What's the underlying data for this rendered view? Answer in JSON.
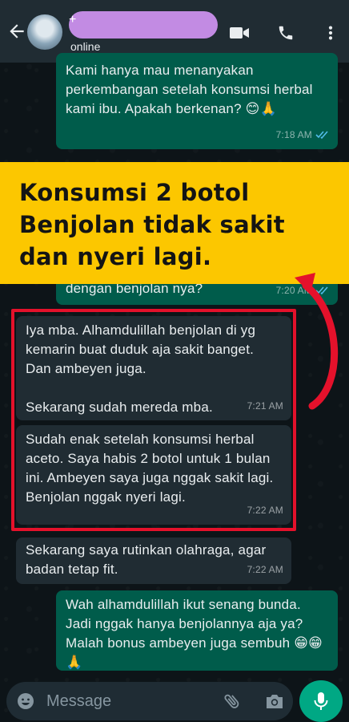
{
  "header": {
    "name_prefix": "+",
    "status": "online"
  },
  "messages": [
    {
      "id": "b1",
      "direction": "out",
      "text": "Kami hanya mau menanyakan perkembangan setelah konsumsi herbal kami ibu. Apakah berkenan? 😊🙏",
      "time": "7:18 AM",
      "read": true
    },
    {
      "id": "b2",
      "direction": "out",
      "text": "dengan benjolan nya?",
      "time": "7:20 AM",
      "read": true
    },
    {
      "id": "b3",
      "direction": "in",
      "text": "Iya mba. Alhamdulillah benjolan di yg kemarin buat duduk aja sakit banget. Dan ambeyen juga.\n\nSekarang sudah mereda mba.",
      "time": "7:21 AM"
    },
    {
      "id": "b4",
      "direction": "in",
      "text": "Sudah enak setelah konsumsi herbal aceto. Saya habis 2 botol untuk 1 bulan ini. Ambeyen saya juga nggak sakit lagi. Benjolan nggak nyeri lagi.",
      "time": "7:22 AM"
    },
    {
      "id": "b5",
      "direction": "in",
      "text": "Sekarang saya rutinkan olahraga, agar badan tetap fit.",
      "time": "7:22 AM"
    },
    {
      "id": "b6",
      "direction": "out",
      "text": "Wah alhamdulillah ikut senang bunda. Jadi nggak hanya benjolannya aja ya? Malah bonus ambeyen juga sembuh 😁😁🙏"
    }
  ],
  "banner": {
    "text": "Konsumsi 2 botol\nBenjolan tidak sakit\ndan nyeri lagi.",
    "bg_color": "#fcc700",
    "text_color": "#141414"
  },
  "annotation": {
    "box_color": "#e4112b",
    "arrow_color": "#e4112b"
  },
  "input": {
    "placeholder": "Message"
  },
  "colors": {
    "header_bg": "#202c33",
    "outgoing_bubble": "#005c4b",
    "incoming_bubble": "#202c33",
    "mic_button": "#00a884",
    "read_ticks": "#53bdeb"
  },
  "icons": [
    "back-arrow-icon",
    "video-call-icon",
    "phone-icon",
    "more-vert-icon",
    "emoji-icon",
    "attach-icon",
    "camera-icon",
    "mic-icon"
  ]
}
